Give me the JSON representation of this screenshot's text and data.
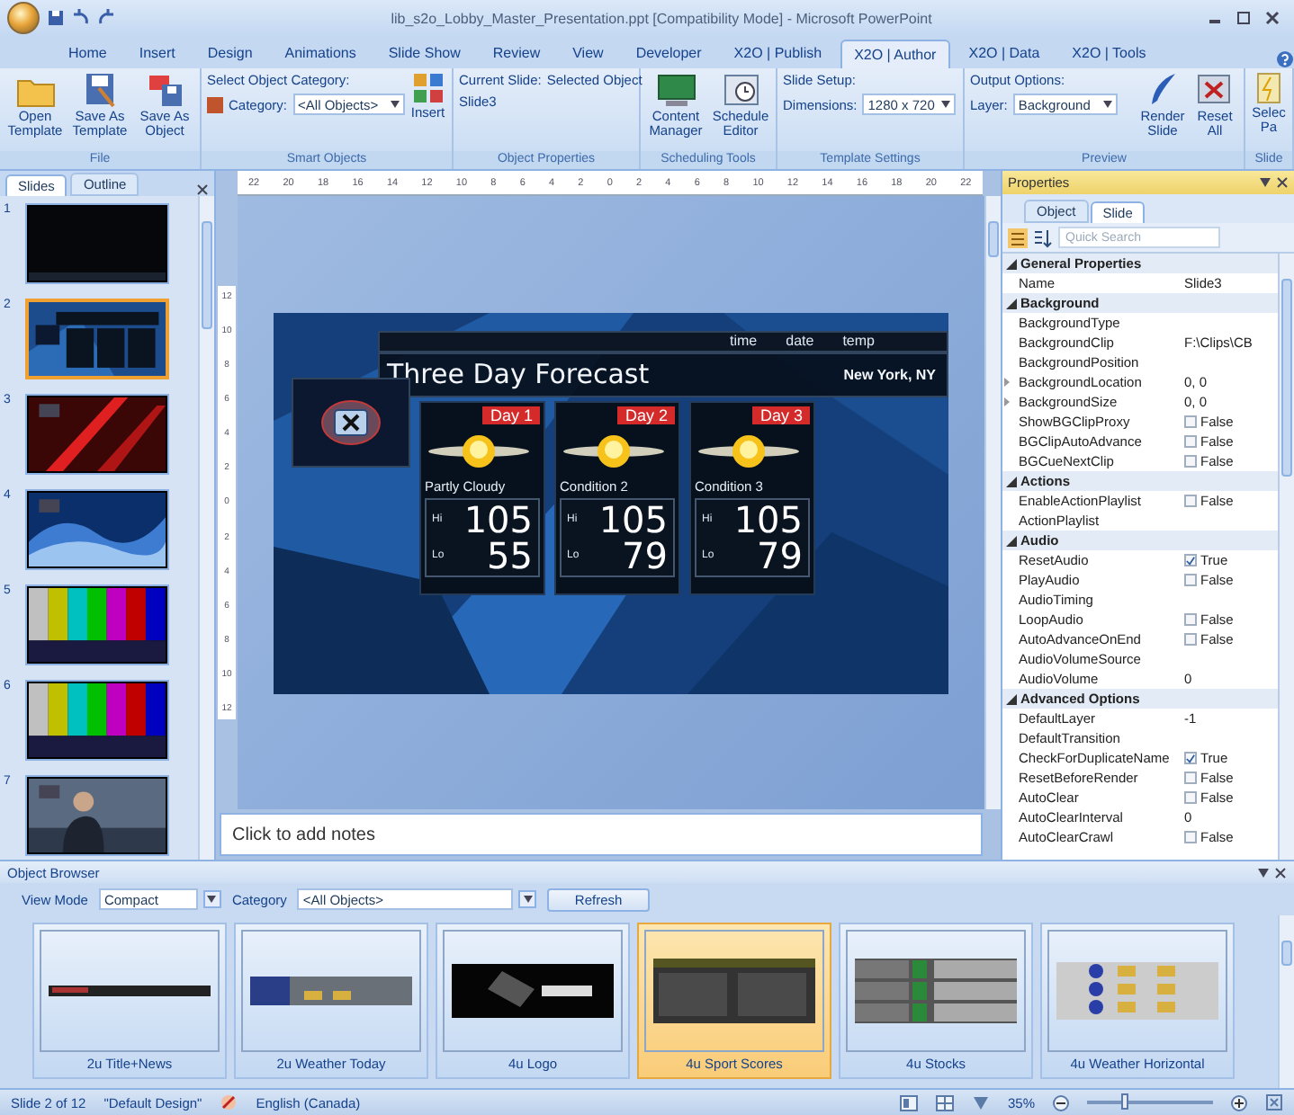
{
  "window": {
    "title": "lib_s2o_Lobby_Master_Presentation.ppt [Compatibility Mode] - Microsoft PowerPoint"
  },
  "tabs": [
    {
      "label": "Home",
      "selected": false
    },
    {
      "label": "Insert",
      "selected": false
    },
    {
      "label": "Design",
      "selected": false
    },
    {
      "label": "Animations",
      "selected": false
    },
    {
      "label": "Slide Show",
      "selected": false
    },
    {
      "label": "Review",
      "selected": false
    },
    {
      "label": "View",
      "selected": false
    },
    {
      "label": "Developer",
      "selected": false
    },
    {
      "label": "X2O | Publish",
      "selected": false
    },
    {
      "label": "X2O | Author",
      "selected": true
    },
    {
      "label": "X2O | Data",
      "selected": false
    },
    {
      "label": "X2O | Tools",
      "selected": false
    }
  ],
  "ribbon": {
    "file": {
      "title": "File",
      "buttons": [
        "Open Template",
        "Save As Template",
        "Save As Object"
      ]
    },
    "smart_objects": {
      "title": "Smart Objects",
      "heading": "Select Object Category:",
      "category_label": "Category:",
      "category_value": "<All Objects>",
      "insert": "Insert"
    },
    "object_properties": {
      "title": "Object Properties",
      "current_slide_label": "Current Slide:",
      "current_slide": "Slide3",
      "selected_object_label": "Selected Object"
    },
    "scheduling": {
      "title": "Scheduling Tools",
      "buttons": [
        "Content Manager",
        "Schedule Editor"
      ]
    },
    "template_settings": {
      "title": "Template Settings",
      "heading": "Slide Setup:",
      "dimensions_label": "Dimensions:",
      "dimensions": "1280 x 720"
    },
    "preview": {
      "title": "Preview",
      "heading": "Output Options:",
      "layer_label": "Layer:",
      "layer": "Background",
      "buttons": [
        "Render Slide",
        "Reset All"
      ]
    },
    "slide_group": {
      "title": "Slide",
      "buttons": [
        "Selec Pa"
      ]
    }
  },
  "slides_panel": {
    "tabs": [
      {
        "label": "Slides",
        "selected": true
      },
      {
        "label": "Outline",
        "selected": false
      }
    ],
    "slides": [
      {
        "number": "1",
        "selected": false,
        "kind": "dark"
      },
      {
        "number": "2",
        "selected": true,
        "kind": "weather"
      },
      {
        "number": "3",
        "selected": false,
        "kind": "red"
      },
      {
        "number": "4",
        "selected": false,
        "kind": "wave"
      },
      {
        "number": "5",
        "selected": false,
        "kind": "bars"
      },
      {
        "number": "6",
        "selected": false,
        "kind": "bars"
      },
      {
        "number": "7",
        "selected": false,
        "kind": "person"
      }
    ]
  },
  "ruler": {
    "horizontal": [
      "22",
      "20",
      "18",
      "16",
      "14",
      "12",
      "10",
      "8",
      "6",
      "4",
      "2",
      "0",
      "2",
      "4",
      "6",
      "8",
      "10",
      "12",
      "14",
      "16",
      "18",
      "20",
      "22"
    ],
    "vertical": [
      "12",
      "10",
      "8",
      "6",
      "4",
      "2",
      "0",
      "2",
      "4",
      "6",
      "8",
      "10",
      "12"
    ]
  },
  "slide": {
    "header_labels": [
      "time",
      "date",
      "temp"
    ],
    "title": "Three Day Forecast",
    "location": "New York, NY",
    "days": [
      {
        "label": "Day 1",
        "condition": "Partly Cloudy",
        "hi_label": "Hi",
        "hi": "105",
        "lo_label": "Lo",
        "lo": "55"
      },
      {
        "label": "Day 2",
        "condition": "Condition 2",
        "hi_label": "Hi",
        "hi": "105",
        "lo_label": "Lo",
        "lo": "79"
      },
      {
        "label": "Day 3",
        "condition": "Condition 3",
        "hi_label": "Hi",
        "hi": "105",
        "lo_label": "Lo",
        "lo": "79"
      }
    ]
  },
  "notes": {
    "placeholder": "Click to add notes"
  },
  "properties": {
    "title": "Properties",
    "tabs": [
      {
        "label": "Object",
        "selected": false
      },
      {
        "label": "Slide",
        "selected": true
      }
    ],
    "search": {
      "placeholder": "Quick Search"
    },
    "categories": [
      {
        "title": "General Properties",
        "expanded": true,
        "rows": [
          {
            "name": "Name",
            "value": "Slide3",
            "kind": "text"
          }
        ]
      },
      {
        "title": "Background",
        "expanded": true,
        "rows": [
          {
            "name": "BackgroundType",
            "kind": "text"
          },
          {
            "name": "BackgroundClip",
            "value": "F:\\Clips\\CB",
            "kind": "text"
          },
          {
            "name": "BackgroundPosition",
            "kind": "text"
          },
          {
            "name": "BackgroundLocation",
            "value": "0, 0",
            "kind": "expandable"
          },
          {
            "name": "BackgroundSize",
            "value": "0, 0",
            "kind": "expandable"
          },
          {
            "name": "ShowBGClipProxy",
            "value": "False",
            "kind": "check",
            "checked": false
          },
          {
            "name": "BGClipAutoAdvance",
            "value": "False",
            "kind": "check",
            "checked": false
          },
          {
            "name": "BGCueNextClip",
            "value": "False",
            "kind": "check",
            "checked": false
          }
        ]
      },
      {
        "title": "Actions",
        "expanded": true,
        "rows": [
          {
            "name": "EnableActionPlaylist",
            "value": "False",
            "kind": "check",
            "checked": false
          },
          {
            "name": "ActionPlaylist",
            "kind": "text"
          }
        ]
      },
      {
        "title": "Audio",
        "expanded": true,
        "rows": [
          {
            "name": "ResetAudio",
            "value": "True",
            "kind": "check",
            "checked": true
          },
          {
            "name": "PlayAudio",
            "value": "False",
            "kind": "check",
            "checked": false
          },
          {
            "name": "AudioTiming",
            "kind": "text"
          },
          {
            "name": "LoopAudio",
            "value": "False",
            "kind": "check",
            "checked": false
          },
          {
            "name": "AutoAdvanceOnEnd",
            "value": "False",
            "kind": "check",
            "checked": false
          },
          {
            "name": "AudioVolumeSource",
            "kind": "text"
          },
          {
            "name": "AudioVolume",
            "value": "0",
            "kind": "text"
          }
        ]
      },
      {
        "title": "Advanced Options",
        "expanded": true,
        "rows": [
          {
            "name": "DefaultLayer",
            "value": "-1",
            "kind": "text"
          },
          {
            "name": "DefaultTransition",
            "kind": "text"
          },
          {
            "name": "CheckForDuplicateName",
            "value": "True",
            "kind": "check",
            "checked": true
          },
          {
            "name": "ResetBeforeRender",
            "value": "False",
            "kind": "check",
            "checked": false
          },
          {
            "name": "AutoClear",
            "value": "False",
            "kind": "check",
            "checked": false
          },
          {
            "name": "AutoClearInterval",
            "value": "0",
            "kind": "text"
          },
          {
            "name": "AutoClearCrawl",
            "value": "False",
            "kind": "check",
            "checked": false
          }
        ]
      }
    ]
  },
  "object_browser": {
    "title": "Object Browser",
    "view_mode_label": "View Mode",
    "view_mode": "Compact",
    "category_label": "Category",
    "category": "<All Objects>",
    "refresh": "Refresh",
    "items": [
      {
        "label": "2u Title+News",
        "selected": false,
        "kind": "ticker"
      },
      {
        "label": "2u Weather Today",
        "selected": false,
        "kind": "weather"
      },
      {
        "label": "4u Logo",
        "selected": false,
        "kind": "logo"
      },
      {
        "label": "4u Sport Scores",
        "selected": true,
        "kind": "scores"
      },
      {
        "label": "4u Stocks",
        "selected": false,
        "kind": "stocks"
      },
      {
        "label": "4u Weather Horizontal",
        "selected": false,
        "kind": "weatherh"
      }
    ]
  },
  "status_bar": {
    "slide": "Slide 2 of 12",
    "design": "\"Default Design\"",
    "language": "English (Canada)",
    "zoom": "35%",
    "zoom_level": {
      "level": 0.3
    }
  }
}
